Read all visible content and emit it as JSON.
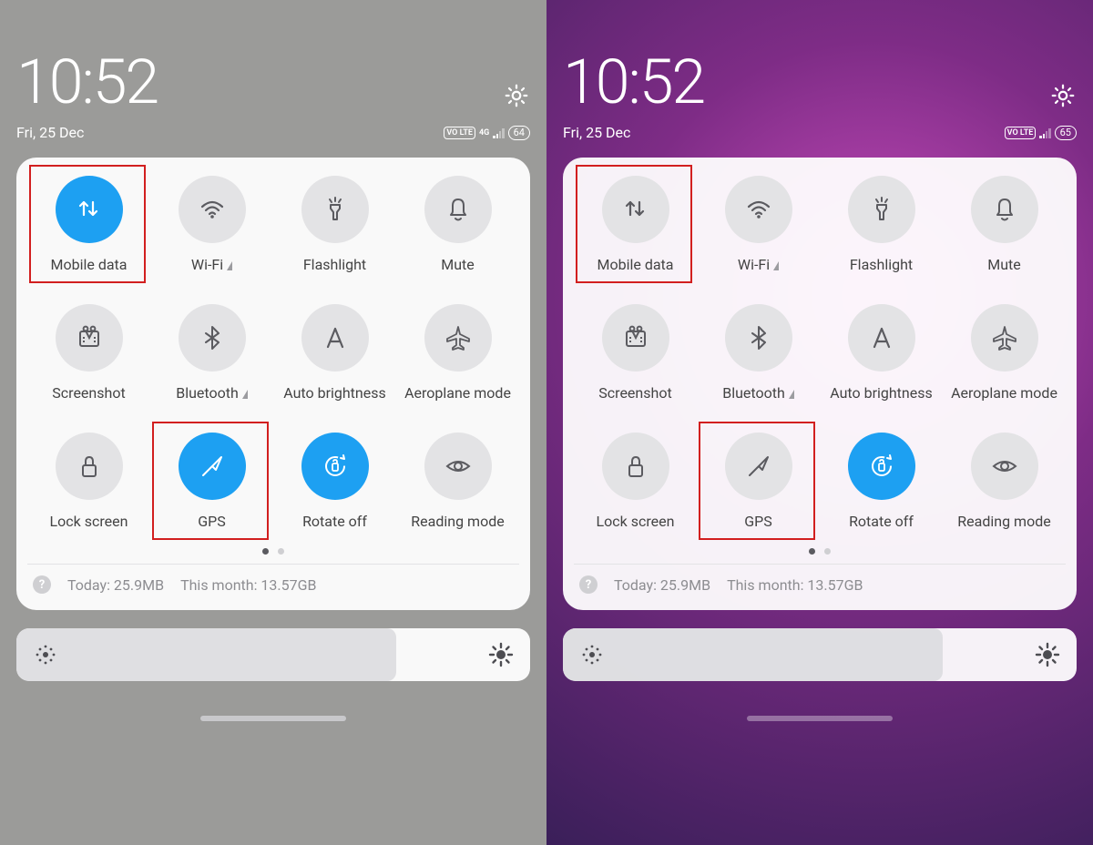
{
  "screens": [
    {
      "time": "10:52",
      "date": "Fri, 25 Dec",
      "battery": "64",
      "net_badge": "VO LTE",
      "net_sup": "4G",
      "tiles": [
        {
          "id": "mobile-data",
          "label": "Mobile data",
          "on": true,
          "highlight": true
        },
        {
          "id": "wifi",
          "label": "Wi-Fi",
          "on": false,
          "tri": true
        },
        {
          "id": "flashlight",
          "label": "Flashlight",
          "on": false
        },
        {
          "id": "mute",
          "label": "Mute",
          "on": false
        },
        {
          "id": "screenshot",
          "label": "Screenshot",
          "on": false
        },
        {
          "id": "bluetooth",
          "label": "Bluetooth",
          "on": false,
          "tri": true
        },
        {
          "id": "auto-brightness",
          "label": "Auto brightness",
          "on": false
        },
        {
          "id": "aeroplane-mode",
          "label": "Aeroplane mode",
          "on": false
        },
        {
          "id": "lock-screen",
          "label": "Lock screen",
          "on": false
        },
        {
          "id": "gps",
          "label": "GPS",
          "on": true,
          "highlight": true
        },
        {
          "id": "rotate-off",
          "label": "Rotate off",
          "on": true
        },
        {
          "id": "reading-mode",
          "label": "Reading mode",
          "on": false
        }
      ],
      "usage_today": "Today: 25.9MB",
      "usage_month": "This month: 13.57GB"
    },
    {
      "time": "10:52",
      "date": "Fri, 25 Dec",
      "battery": "65",
      "net_badge": "VO LTE",
      "net_sup": "",
      "tiles": [
        {
          "id": "mobile-data",
          "label": "Mobile data",
          "on": false,
          "highlight": true
        },
        {
          "id": "wifi",
          "label": "Wi-Fi",
          "on": false,
          "tri": true
        },
        {
          "id": "flashlight",
          "label": "Flashlight",
          "on": false
        },
        {
          "id": "mute",
          "label": "Mute",
          "on": false
        },
        {
          "id": "screenshot",
          "label": "Screenshot",
          "on": false
        },
        {
          "id": "bluetooth",
          "label": "Bluetooth",
          "on": false,
          "tri": true
        },
        {
          "id": "auto-brightness",
          "label": "Auto brightness",
          "on": false
        },
        {
          "id": "aeroplane-mode",
          "label": "Aeroplane mode",
          "on": false
        },
        {
          "id": "lock-screen",
          "label": "Lock screen",
          "on": false
        },
        {
          "id": "gps",
          "label": "GPS",
          "on": false,
          "highlight": true
        },
        {
          "id": "rotate-off",
          "label": "Rotate off",
          "on": true
        },
        {
          "id": "reading-mode",
          "label": "Reading mode",
          "on": false
        }
      ],
      "usage_today": "Today: 25.9MB",
      "usage_month": "This month: 13.57GB"
    }
  ]
}
